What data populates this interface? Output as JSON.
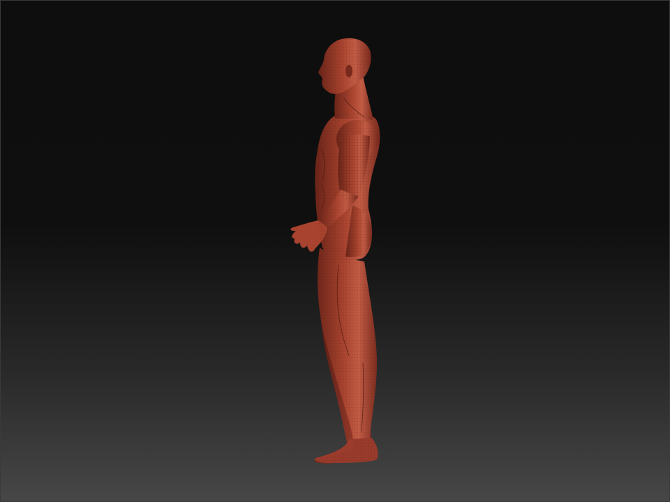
{
  "scene": {
    "background_top": "#0e0e0e",
    "background_bottom": "#474747",
    "model": {
      "name": "human-male-figure",
      "view": "side-profile",
      "material_color": "#9a3b2c",
      "material_highlight": "#c7604a",
      "material_shadow": "#5e1f16",
      "wireframe": true
    }
  }
}
